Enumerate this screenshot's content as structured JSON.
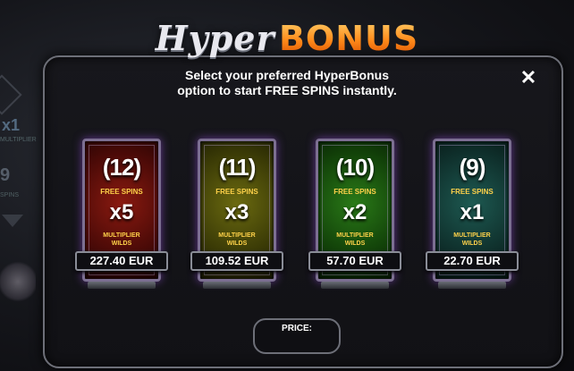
{
  "title": {
    "hyper": "Hyper",
    "bonus": "BONUS"
  },
  "instruction": {
    "line1": "Select your preferred HyperBonus",
    "line2": "option to start FREE SPINS instantly."
  },
  "close_label": "✕",
  "background": {
    "multiplier_value": "x1",
    "multiplier_label": "MULTIPLIER",
    "spins_value": "9",
    "spins_label": "SPINS"
  },
  "cards": [
    {
      "spins": "12",
      "spins_label": "FREE SPINS",
      "multiplier": "x5",
      "multiplier_label_1": "MULTIPLIER",
      "multiplier_label_2": "WILDS",
      "price": "227.40 EUR",
      "color": "#8a1a10"
    },
    {
      "spins": "11",
      "spins_label": "FREE SPINS",
      "multiplier": "x3",
      "multiplier_label_1": "MULTIPLIER",
      "multiplier_label_2": "WILDS",
      "price": "109.52 EUR",
      "color": "#6b6a10"
    },
    {
      "spins": "10",
      "spins_label": "FREE SPINS",
      "multiplier": "x2",
      "multiplier_label_1": "MULTIPLIER",
      "multiplier_label_2": "WILDS",
      "price": "57.70 EUR",
      "color": "#2a7a18"
    },
    {
      "spins": "9",
      "spins_label": "FREE SPINS",
      "multiplier": "x1",
      "multiplier_label_1": "MULTIPLIER",
      "multiplier_label_2": "WILDS",
      "price": "22.70 EUR",
      "color": "#1e5a52"
    }
  ],
  "price_label": "PRICE:",
  "colors": {
    "accent_orange": "#ff8a1a",
    "label_yellow": "#ffd24a",
    "frame_purple": "#7c6f92"
  }
}
